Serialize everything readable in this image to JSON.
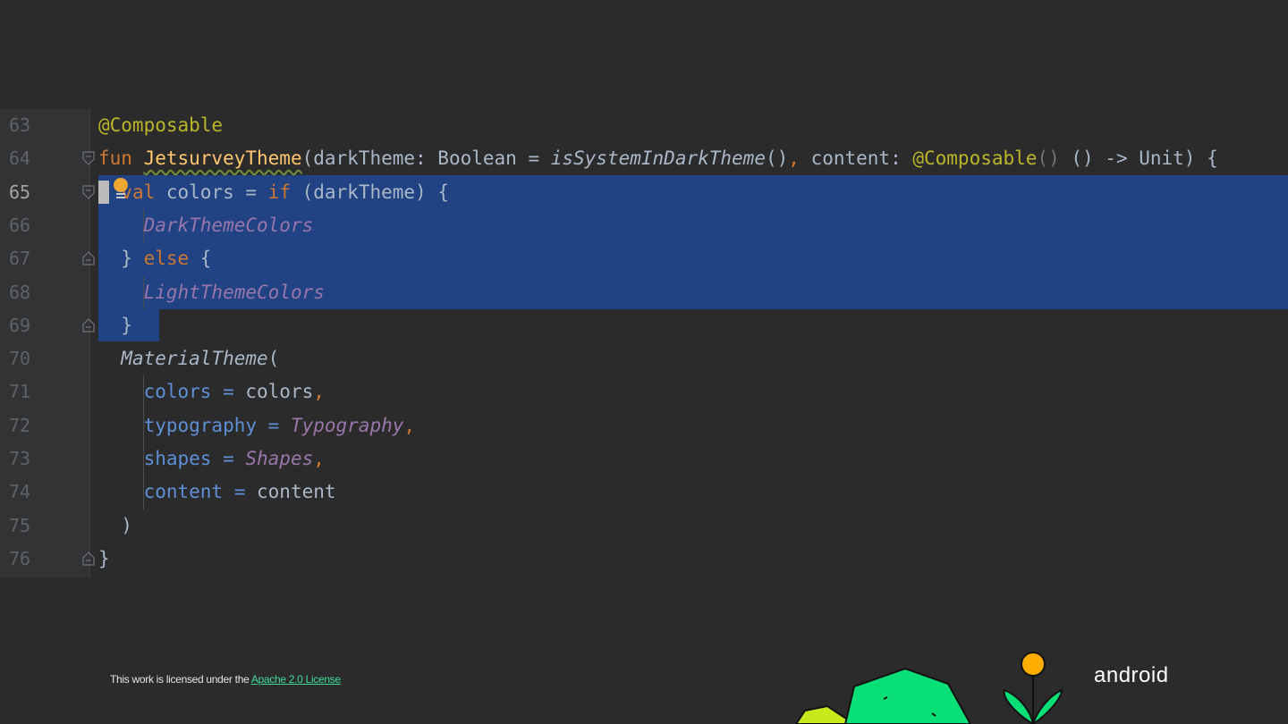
{
  "editor": {
    "lines": [
      {
        "number": "63",
        "parts": [
          {
            "t": "@Composable",
            "c": "ann"
          }
        ]
      },
      {
        "number": "64",
        "parts": [
          {
            "t": "fun ",
            "c": "kw"
          },
          {
            "t": "JetsurveyTheme",
            "c": "fn squiggle"
          },
          {
            "t": "(darkTheme: Boolean = ",
            "c": "plain"
          },
          {
            "t": "isSystemInDarkTheme",
            "c": "plain it"
          },
          {
            "t": "()",
            "c": "plain"
          },
          {
            "t": ", ",
            "c": "kw"
          },
          {
            "t": "content: ",
            "c": "plain"
          },
          {
            "t": "@Composable",
            "c": "ann"
          },
          {
            "t": "() ",
            "c": "dim"
          },
          {
            "t": "() -> Unit) {",
            "c": "plain"
          }
        ]
      },
      {
        "number": "65",
        "current": true,
        "parts": [
          {
            "t": "  ",
            "c": "plain"
          },
          {
            "t": "val ",
            "c": "kw"
          },
          {
            "t": "colors = ",
            "c": "plain"
          },
          {
            "t": "if ",
            "c": "kw"
          },
          {
            "t": "(darkTheme) {",
            "c": "plain"
          }
        ]
      },
      {
        "number": "66",
        "parts": [
          {
            "t": "    ",
            "c": "plain"
          },
          {
            "t": "DarkThemeColors",
            "c": "prop"
          }
        ]
      },
      {
        "number": "67",
        "parts": [
          {
            "t": "  } ",
            "c": "plain"
          },
          {
            "t": "else ",
            "c": "kw"
          },
          {
            "t": "{",
            "c": "plain"
          }
        ]
      },
      {
        "number": "68",
        "parts": [
          {
            "t": "    ",
            "c": "plain"
          },
          {
            "t": "LightThemeColors",
            "c": "prop"
          }
        ]
      },
      {
        "number": "69",
        "parts": [
          {
            "t": "  }",
            "c": "plain"
          }
        ]
      },
      {
        "number": "70",
        "parts": [
          {
            "t": "  ",
            "c": "plain"
          },
          {
            "t": "MaterialTheme",
            "c": "plain it"
          },
          {
            "t": "(",
            "c": "plain"
          }
        ]
      },
      {
        "number": "71",
        "parts": [
          {
            "t": "    ",
            "c": "plain"
          },
          {
            "t": "colors = ",
            "c": "param"
          },
          {
            "t": "colors",
            "c": "plain"
          },
          {
            "t": ",",
            "c": "kw"
          }
        ]
      },
      {
        "number": "72",
        "parts": [
          {
            "t": "    ",
            "c": "plain"
          },
          {
            "t": "typography = ",
            "c": "param"
          },
          {
            "t": "Typography",
            "c": "prop"
          },
          {
            "t": ",",
            "c": "kw"
          }
        ]
      },
      {
        "number": "73",
        "parts": [
          {
            "t": "    ",
            "c": "plain"
          },
          {
            "t": "shapes = ",
            "c": "param"
          },
          {
            "t": "Shapes",
            "c": "prop"
          },
          {
            "t": ",",
            "c": "kw"
          }
        ]
      },
      {
        "number": "74",
        "parts": [
          {
            "t": "    ",
            "c": "plain"
          },
          {
            "t": "content = ",
            "c": "param"
          },
          {
            "t": "content",
            "c": "plain"
          }
        ]
      },
      {
        "number": "75",
        "parts": [
          {
            "t": "  )",
            "c": "plain"
          }
        ]
      },
      {
        "number": "76",
        "parts": [
          {
            "t": "}",
            "c": "plain"
          }
        ]
      }
    ],
    "colors": {
      "background": "#2b2b2b",
      "selection": "#214283",
      "keyword": "#cc7832",
      "annotation": "#bbb529",
      "function": "#ffc66d",
      "property": "#9876aa",
      "parameter": "#5f8fd6",
      "text": "#a9b7c6"
    },
    "icons": [
      "fold-icon",
      "intention-bulb-icon",
      "caret"
    ]
  },
  "footer": {
    "license_prefix": "This work is licensed under the ",
    "license_link": "Apache 2.0 License",
    "brand": "android",
    "link_color": "#3ddc97"
  }
}
